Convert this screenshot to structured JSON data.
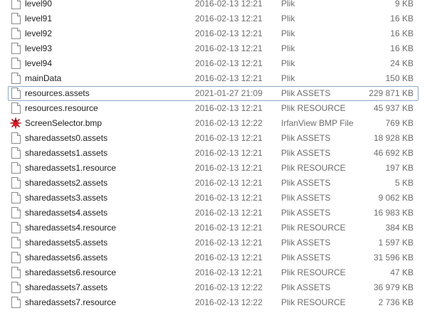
{
  "files": [
    {
      "name": "level90",
      "date": "2016-02-13 12:21",
      "type": "Plik",
      "size": "9 KB",
      "icon": "blank-file-icon"
    },
    {
      "name": "level91",
      "date": "2016-02-13 12:21",
      "type": "Plik",
      "size": "16 KB",
      "icon": "blank-file-icon"
    },
    {
      "name": "level92",
      "date": "2016-02-13 12:21",
      "type": "Plik",
      "size": "16 KB",
      "icon": "blank-file-icon"
    },
    {
      "name": "level93",
      "date": "2016-02-13 12:21",
      "type": "Plik",
      "size": "16 KB",
      "icon": "blank-file-icon"
    },
    {
      "name": "level94",
      "date": "2016-02-13 12:21",
      "type": "Plik",
      "size": "24 KB",
      "icon": "blank-file-icon"
    },
    {
      "name": "mainData",
      "date": "2016-02-13 12:21",
      "type": "Plik",
      "size": "150 KB",
      "icon": "blank-file-icon"
    },
    {
      "name": "resources.assets",
      "date": "2021-01-27 21:09",
      "type": "Plik ASSETS",
      "size": "229 871 KB",
      "icon": "blank-file-icon",
      "selected": true
    },
    {
      "name": "resources.resource",
      "date": "2016-02-13 12:21",
      "type": "Plik RESOURCE",
      "size": "45 937 KB",
      "icon": "blank-file-icon"
    },
    {
      "name": "ScreenSelector.bmp",
      "date": "2016-02-13 12:22",
      "type": "IrfanView BMP File",
      "size": "769 KB",
      "icon": "irfanview-bmp-icon"
    },
    {
      "name": "sharedassets0.assets",
      "date": "2016-02-13 12:21",
      "type": "Plik ASSETS",
      "size": "18 928 KB",
      "icon": "blank-file-icon"
    },
    {
      "name": "sharedassets1.assets",
      "date": "2016-02-13 12:21",
      "type": "Plik ASSETS",
      "size": "46 692 KB",
      "icon": "blank-file-icon"
    },
    {
      "name": "sharedassets1.resource",
      "date": "2016-02-13 12:21",
      "type": "Plik RESOURCE",
      "size": "197 KB",
      "icon": "blank-file-icon"
    },
    {
      "name": "sharedassets2.assets",
      "date": "2016-02-13 12:21",
      "type": "Plik ASSETS",
      "size": "5 KB",
      "icon": "blank-file-icon"
    },
    {
      "name": "sharedassets3.assets",
      "date": "2016-02-13 12:21",
      "type": "Plik ASSETS",
      "size": "9 062 KB",
      "icon": "blank-file-icon"
    },
    {
      "name": "sharedassets4.assets",
      "date": "2016-02-13 12:21",
      "type": "Plik ASSETS",
      "size": "16 983 KB",
      "icon": "blank-file-icon"
    },
    {
      "name": "sharedassets4.resource",
      "date": "2016-02-13 12:21",
      "type": "Plik RESOURCE",
      "size": "384 KB",
      "icon": "blank-file-icon"
    },
    {
      "name": "sharedassets5.assets",
      "date": "2016-02-13 12:21",
      "type": "Plik ASSETS",
      "size": "1 597 KB",
      "icon": "blank-file-icon"
    },
    {
      "name": "sharedassets6.assets",
      "date": "2016-02-13 12:21",
      "type": "Plik ASSETS",
      "size": "31 596 KB",
      "icon": "blank-file-icon"
    },
    {
      "name": "sharedassets6.resource",
      "date": "2016-02-13 12:21",
      "type": "Plik RESOURCE",
      "size": "47 KB",
      "icon": "blank-file-icon"
    },
    {
      "name": "sharedassets7.assets",
      "date": "2016-02-13 12:22",
      "type": "Plik ASSETS",
      "size": "36 979 KB",
      "icon": "blank-file-icon"
    },
    {
      "name": "sharedassets7.resource",
      "date": "2016-02-13 12:22",
      "type": "Plik RESOURCE",
      "size": "2 736 KB",
      "icon": "blank-file-icon"
    }
  ],
  "colors": {
    "text": "#1e1e1e",
    "secondary_text": "#6d6d6d",
    "selection_border": "#8ea8c4",
    "background": "#ffffff"
  }
}
